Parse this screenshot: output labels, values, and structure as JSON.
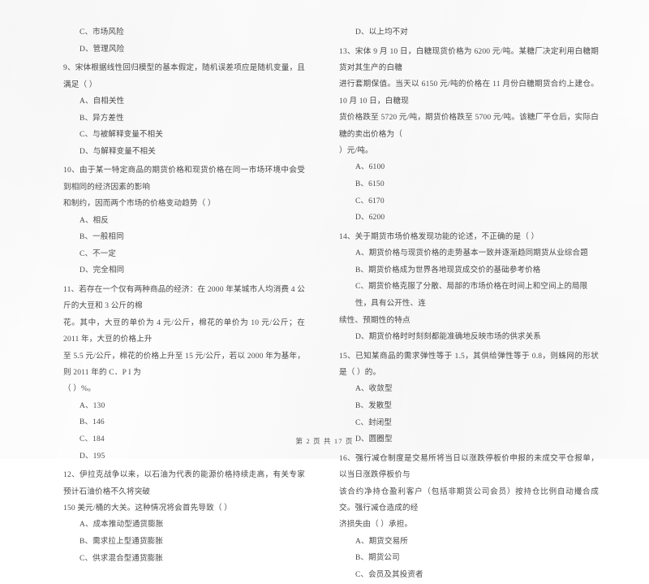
{
  "document": {
    "footer": "第 2 页 共 17 页"
  },
  "left_column": {
    "orphan_options": [
      "C、市场风险",
      "D、管理风险"
    ],
    "questions": [
      {
        "number": "9",
        "stem": "9、宋体根据线性回归模型的基本假定，随机误差项应是随机变量，且满足（      ）",
        "options": [
          "A、自相关性",
          "B、异方差性",
          "C、与被解释变量不相关",
          "D、与解释变量不相关"
        ]
      },
      {
        "number": "10",
        "stem": "10、由于某一特定商品的期货价格和现货价格在同一市场环境中会受到相同的经济因素的影响",
        "stem_cont": "和制约，因而两个市场的价格变动趋势（      ）",
        "options": [
          "A、相反",
          "B、一般相同",
          "C、不一定",
          "D、完全相同"
        ]
      },
      {
        "number": "11",
        "stem": "11、若存在一个仅有两种商品的经济：在 2000 年某城市人均消费 4 公斤的大豆和 3 公斤的棉",
        "stem_cont": "花。其中，大豆的单价为 4 元/公斤，棉花的单价为 10 元/公斤；在 2011 年，大豆的价格上升",
        "stem_cont2": "至 5.5 元/公斤，棉花的价格上升至 15 元/公斤，若以 2000 年为基年，则 2011 年的 C．P I 为",
        "stem_cont3": "（      ）%。",
        "options": [
          "A、130",
          "B、146",
          "C、184",
          "D、195"
        ]
      },
      {
        "number": "12",
        "stem": "12、伊拉克战争以来，以石油为代表的能源价格持续走高，有关专家预计石油价格不久将突破",
        "stem_cont": "150 美元/桶的大关。这种情况将会首先导致（      ）",
        "options": [
          "A、成本推动型通货膨胀",
          "B、需求拉上型通货膨胀",
          "C、供求混合型通货膨胀"
        ]
      }
    ]
  },
  "right_column": {
    "orphan_options": [
      "D、以上均不对"
    ],
    "questions": [
      {
        "number": "13",
        "stem": "13、宋体 9 月 10 日，白糖现货价格为 6200 元/吨。某糖厂决定利用白糖期货对其生产的白糖",
        "stem_cont": "进行套期保值。当天以 6150 元/吨的价格在 11 月份白糖期货合约上建仓。10 月 10 日，白糖现",
        "stem_cont2": "货价格跌至 5720 元/吨，期货价格跌至 5700 元/吨。该糖厂平仓后，实际白糖的卖出价格为（",
        "stem_cont3": "）元/吨。",
        "options": [
          "A、6100",
          "B、6150",
          "C、6170",
          "D、6200"
        ]
      },
      {
        "number": "14",
        "stem": "14、关于期货市场价格发现功能的论述，不正确的是（      ）",
        "options": [
          "A、期货价格与现货价格的走势基本一致并逐渐趋同期货从业综合题",
          "B、期货价格成为世界各地现货成交价的基础参考价格",
          "C、期货价格克服了分散、局部的市场价格在时间上和空间上的局限性，具有公开性、连",
          "D、期货价格时时刻刻都能准确地反映市场的供求关系"
        ],
        "option_c_cont": "续性、预期性的特点"
      },
      {
        "number": "15",
        "stem": "15、已知某商品的需求弹性等于 1.5，其供给弹性等于 0.8，则蛛网的形状是（      ）的。",
        "options": [
          "A、收敛型",
          "B、发散型",
          "C、封闭型",
          "D、圆圈型"
        ]
      },
      {
        "number": "16",
        "stem": "16、强行减仓制度是交易所将当日以涨跌停板价申报的未成交平仓报单，以当日涨跌停板价与",
        "stem_cont": "该合约净持仓盈利客户（包括非期货公司会员）按持仓比例自动撮合成交。强行减仓造成的经",
        "stem_cont2": "济损失由（      ）承担。",
        "options": [
          "A、期货交易所",
          "B、期货公司",
          "C、会员及其投资者"
        ]
      }
    ]
  }
}
